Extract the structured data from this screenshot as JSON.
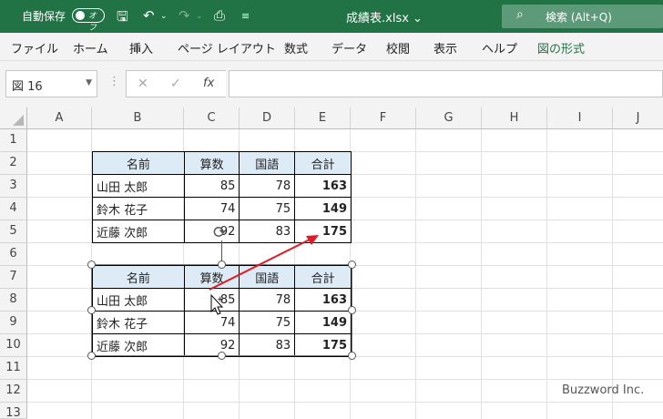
{
  "titlebar": {
    "autosave_label": "自動保存",
    "autosave_state": "オフ",
    "filename": "成績表.xlsx ⌄",
    "search_label": "検索 (Alt+Q)"
  },
  "menu": [
    "ファイル",
    "ホーム",
    "挿入",
    "ページ レイアウト",
    "数式",
    "データ",
    "校閲",
    "表示",
    "ヘルプ",
    "図の形式"
  ],
  "formula_bar": {
    "name_box": "図 16",
    "fx": "fx",
    "formula": ""
  },
  "columns": [
    "A",
    "B",
    "C",
    "D",
    "E",
    "F",
    "G",
    "H",
    "I",
    "J"
  ],
  "rows": [
    "1",
    "2",
    "3",
    "4",
    "5",
    "6",
    "7",
    "8",
    "9",
    "10",
    "11",
    "12",
    "13"
  ],
  "table": {
    "headers": [
      "名前",
      "算数",
      "国語",
      "合計"
    ],
    "rows": [
      [
        "山田 太郎",
        "85",
        "78",
        "163"
      ],
      [
        "鈴木 花子",
        "74",
        "75",
        "149"
      ],
      [
        "近藤 次郎",
        "92",
        "83",
        "175"
      ]
    ]
  },
  "picture": {
    "headers": [
      "名前",
      "算数",
      "国語",
      "合計"
    ],
    "rows": [
      [
        "山田 太郎",
        "85",
        "78",
        "163"
      ],
      [
        "鈴木 花子",
        "74",
        "75",
        "149"
      ],
      [
        "近藤 次郎",
        "92",
        "83",
        "175"
      ]
    ]
  },
  "watermark": "Buzzword Inc.",
  "colors": {
    "accent": "#217346",
    "header_fill": "#ddebf7",
    "arrow": "#e11b22"
  }
}
